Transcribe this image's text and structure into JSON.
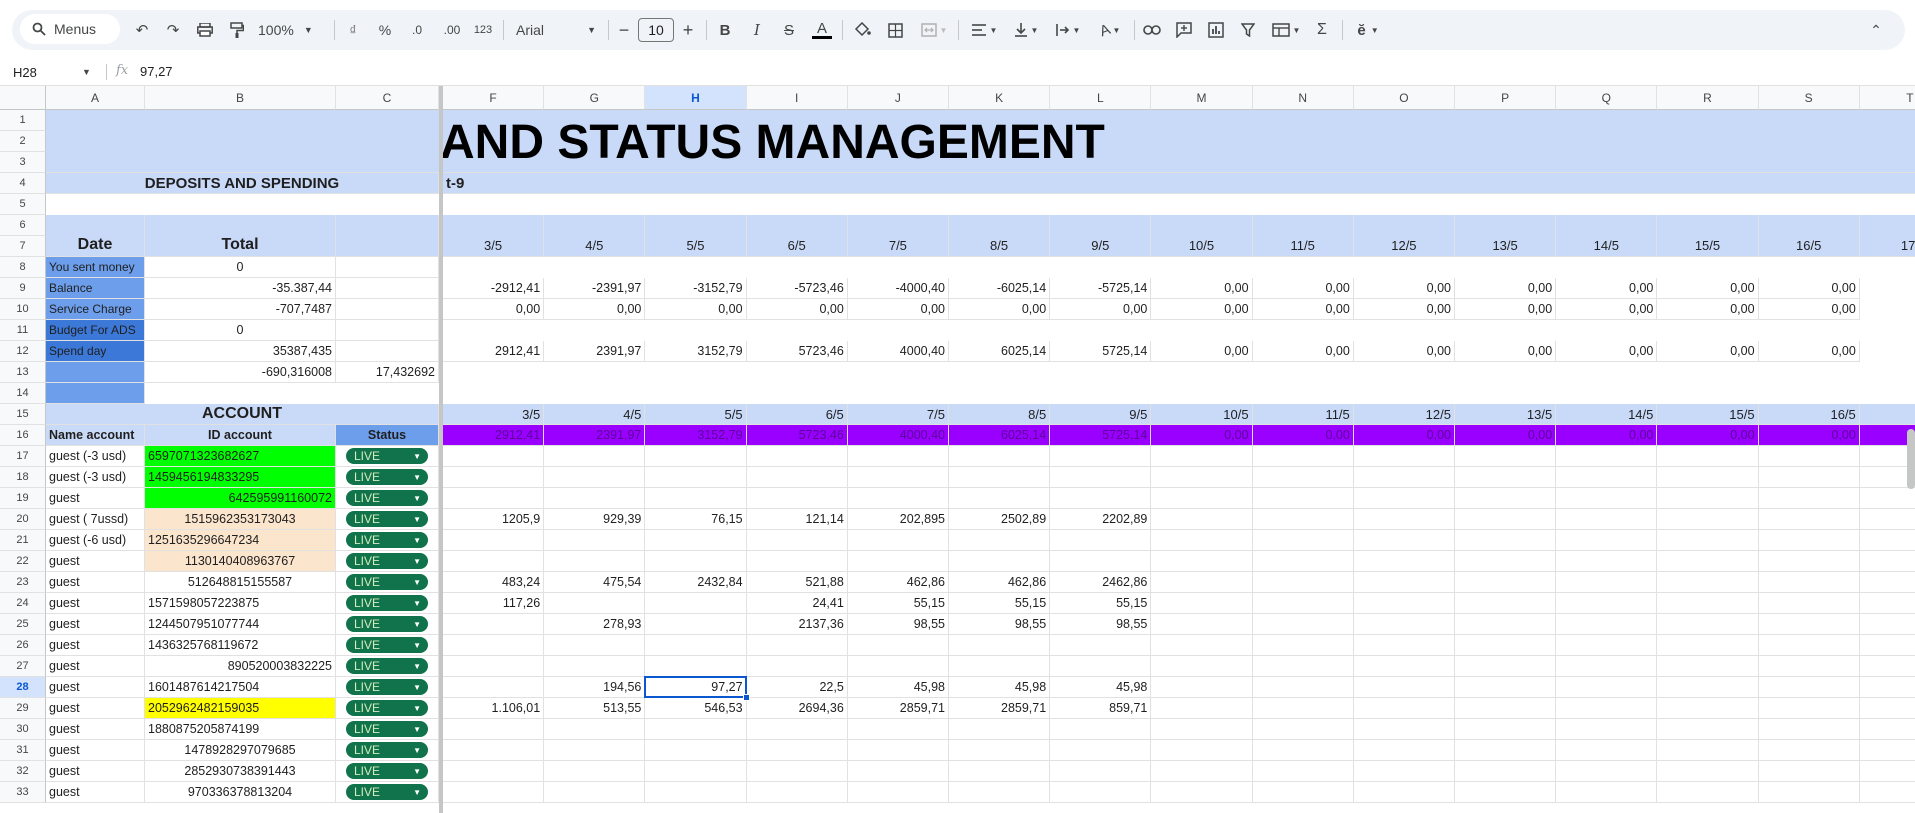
{
  "toolbar": {
    "menus_label": "Menus",
    "zoom": "100%",
    "font_name": "Arial",
    "font_size": "10",
    "currency_symbol": "₫",
    "percent_symbol": "%",
    "decrease_decimals": ".0",
    "increase_decimals": ".00",
    "number_format": "123",
    "bold": "B",
    "italic": "I",
    "strike": "S",
    "text_color": "A",
    "rotate": "A"
  },
  "formula_bar": {
    "cell_ref": "H28",
    "value": "97,27"
  },
  "columns_left": [
    "A",
    "B",
    "C"
  ],
  "columns_right": [
    "F",
    "G",
    "H",
    "I",
    "J",
    "K",
    "L",
    "M",
    "N",
    "O",
    "P",
    "Q",
    "R",
    "S",
    "T"
  ],
  "row_numbers": [
    "1",
    "2",
    "3",
    "4",
    "5",
    "6",
    "7",
    "8",
    "9",
    "10",
    "11",
    "12",
    "13",
    "14",
    "15",
    "16",
    "17",
    "18",
    "19",
    "20",
    "21",
    "22",
    "23",
    "24",
    "25",
    "26",
    "27",
    "28",
    "29",
    "30",
    "31",
    "32",
    "33"
  ],
  "title_fragment": "AND STATUS MANAGEMENT",
  "subtitle_fragment": "t-9",
  "deposits_header": "DEPOSITS AND SPENDING",
  "summary": {
    "date_label": "Date",
    "total_label": "Total",
    "rows": [
      {
        "label": "You sent money",
        "total": "0",
        "c": ""
      },
      {
        "label": "Balance",
        "total": "-35.387,44",
        "c": ""
      },
      {
        "label": "Service Charge",
        "total": "-707,7487",
        "c": ""
      },
      {
        "label": "Budget For  ADS",
        "total": "0",
        "c": ""
      },
      {
        "label": "Spend day",
        "total": "35387,435",
        "c": ""
      },
      {
        "label": "",
        "total": "-690,316008",
        "c": "17,432692"
      }
    ]
  },
  "dates_row7": [
    "3/5",
    "4/5",
    "5/5",
    "6/5",
    "7/5",
    "8/5",
    "9/5",
    "10/5",
    "11/5",
    "12/5",
    "13/5",
    "14/5",
    "15/5",
    "16/5",
    "17/"
  ],
  "daily": {
    "balance": [
      "-2912,41",
      "-2391,97",
      "-3152,79",
      "-5723,46",
      "-4000,40",
      "-6025,14",
      "-5725,14",
      "0,00",
      "0,00",
      "0,00",
      "0,00",
      "0,00",
      "0,00",
      "0,00"
    ],
    "service": [
      "0,00",
      "0,00",
      "0,00",
      "0,00",
      "0,00",
      "0,00",
      "0,00",
      "0,00",
      "0,00",
      "0,00",
      "0,00",
      "0,00",
      "0,00",
      "0,00"
    ],
    "spend": [
      "2912,41",
      "2391,97",
      "3152,79",
      "5723,46",
      "4000,40",
      "6025,14",
      "5725,14",
      "0,00",
      "0,00",
      "0,00",
      "0,00",
      "0,00",
      "0,00",
      "0,00"
    ]
  },
  "account_header": "ACCOUNT",
  "account_cols": {
    "name": "Name account",
    "id": "ID account",
    "status": "Status"
  },
  "dates_row15": [
    "3/5",
    "4/5",
    "5/5",
    "6/5",
    "7/5",
    "8/5",
    "9/5",
    "10/5",
    "11/5",
    "12/5",
    "13/5",
    "14/5",
    "15/5",
    "16/5"
  ],
  "totals_row16": [
    "2912,41",
    "2391,97",
    "3152,79",
    "5723,46",
    "4000,40",
    "6025,14",
    "5725,14",
    "0,00",
    "0,00",
    "0,00",
    "0,00",
    "0,00",
    "0,00",
    "0,00"
  ],
  "accounts": [
    {
      "name": "guest  (-3 usd)",
      "id": "6597071323682627",
      "status": "LIVE",
      "vals": [
        "",
        "",
        "",
        "",
        "",
        "",
        ""
      ]
    },
    {
      "name": "guest  (-3 usd)",
      "id": "1459456194833295",
      "status": "LIVE",
      "vals": [
        "",
        "",
        "",
        "",
        "",
        "",
        ""
      ]
    },
    {
      "name": "guest",
      "id": "642595991160072",
      "status": "LIVE",
      "vals": [
        "",
        "",
        "",
        "",
        "",
        "",
        ""
      ]
    },
    {
      "name": "guest  ( 7ussd)",
      "id": "1515962353173043",
      "status": "LIVE",
      "vals": [
        "1205,9",
        "929,39",
        "76,15",
        "121,14",
        "202,895",
        "2502,89",
        "2202,89"
      ]
    },
    {
      "name": "guest  (-6 usd)",
      "id": "1251635296647234",
      "status": "LIVE",
      "vals": [
        "",
        "",
        "",
        "",
        "",
        "",
        ""
      ]
    },
    {
      "name": "guest",
      "id": "1130140408963767",
      "status": "LIVE",
      "vals": [
        "",
        "",
        "",
        "",
        "",
        "",
        ""
      ]
    },
    {
      "name": "guest",
      "id": "512648815155587",
      "status": "LIVE",
      "vals": [
        "483,24",
        "475,54",
        "2432,84",
        "521,88",
        "462,86",
        "462,86",
        "2462,86"
      ]
    },
    {
      "name": "guest",
      "id": "1571598057223875",
      "status": "LIVE",
      "vals": [
        "117,26",
        "",
        "",
        "24,41",
        "55,15",
        "55,15",
        "55,15"
      ]
    },
    {
      "name": "guest",
      "id": "1244507951077744",
      "status": "LIVE",
      "vals": [
        "",
        "278,93",
        "",
        "2137,36",
        "98,55",
        "98,55",
        "98,55"
      ]
    },
    {
      "name": "guest",
      "id": "1436325768119672",
      "status": "LIVE",
      "vals": [
        "",
        "",
        "",
        "",
        "",
        "",
        ""
      ]
    },
    {
      "name": "guest",
      "id": "890520003832225",
      "status": "LIVE",
      "vals": [
        "",
        "",
        "",
        "",
        "",
        "",
        ""
      ]
    },
    {
      "name": "guest",
      "id": "1601487614217504",
      "status": "LIVE",
      "vals": [
        "",
        "194,56",
        "97,27",
        "22,5",
        "45,98",
        "45,98",
        "45,98"
      ]
    },
    {
      "name": "guest",
      "id": "2052962482159035",
      "status": "LIVE",
      "vals": [
        "1.106,01",
        "513,55",
        "546,53",
        "2694,36",
        "2859,71",
        "2859,71",
        "859,71"
      ]
    },
    {
      "name": "guest",
      "id": "1880875205874199",
      "status": "LIVE",
      "vals": [
        "",
        "",
        "",
        "",
        "",
        "",
        ""
      ]
    },
    {
      "name": "guest",
      "id": "1478928297079685",
      "status": "LIVE",
      "vals": [
        "",
        "",
        "",
        "",
        "",
        "",
        ""
      ]
    },
    {
      "name": "guest",
      "id": "2852930738391443",
      "status": "LIVE",
      "vals": [
        "",
        "",
        "",
        "",
        "",
        "",
        ""
      ]
    },
    {
      "name": "guest",
      "id": "970336378813204",
      "status": "LIVE",
      "vals": [
        "",
        "",
        "",
        "",
        "",
        "",
        ""
      ]
    }
  ],
  "colors": {
    "header_blue": "#c9daf8",
    "label_blue": "#6d9eeb",
    "dark_blue": "#3c78d8",
    "total_purple": "#9900ff",
    "id_green": "#00ff00",
    "id_peach": "#fce5cd",
    "id_yellow": "#ffff00",
    "status_green": "#11734b"
  }
}
